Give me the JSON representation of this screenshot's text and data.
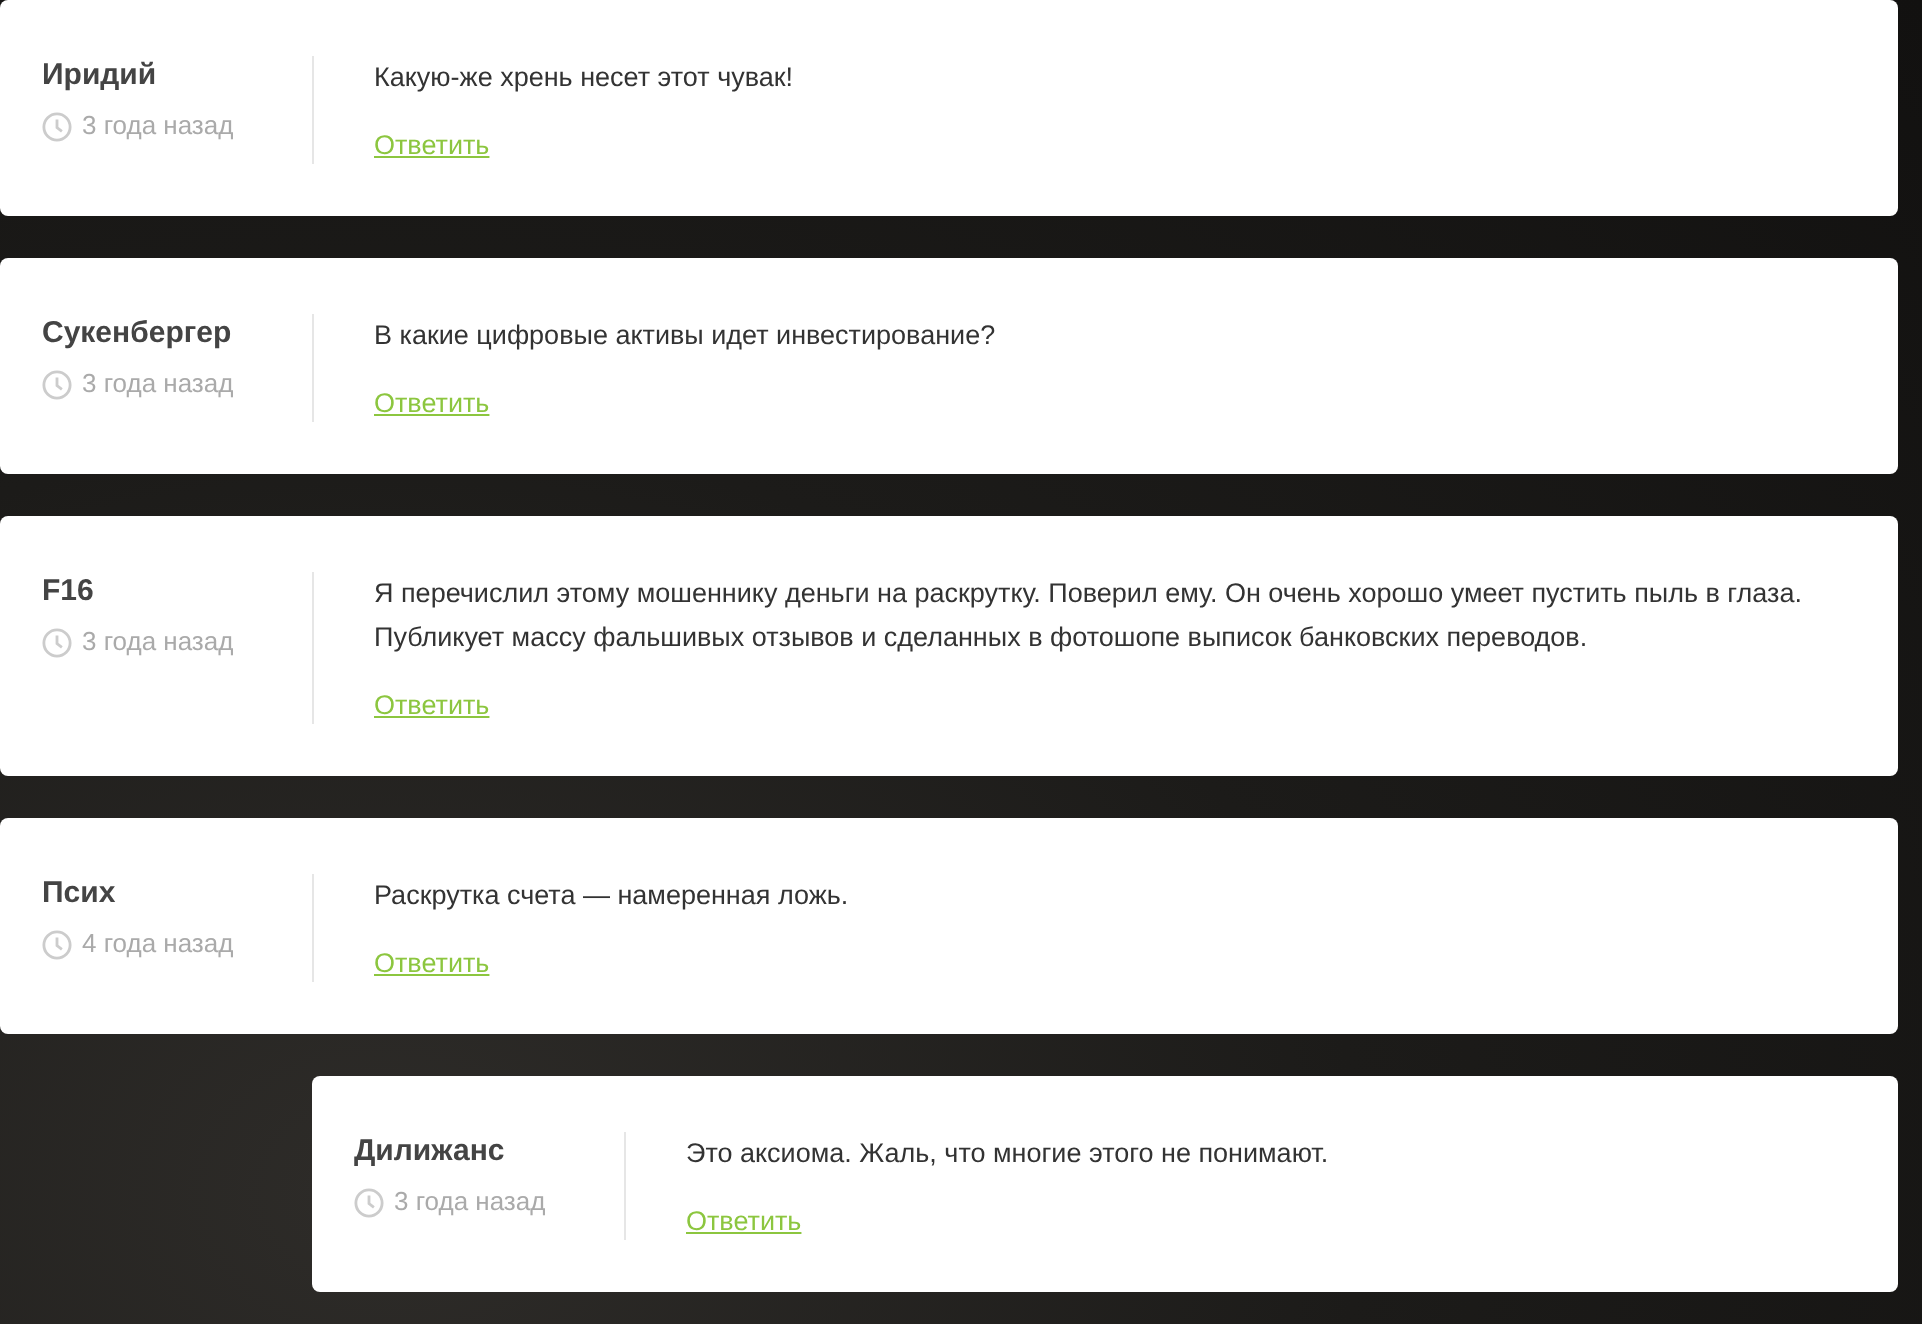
{
  "comments": [
    {
      "kind": "comment",
      "author": "Иридий",
      "time": "3 года назад",
      "text": "Какую-же хрень несет этот чувак!",
      "reply": "Ответить"
    },
    {
      "kind": "comment",
      "author": "Сукенбергер",
      "time": "3 года назад",
      "text": "В какие цифровые активы идет инвестирование?",
      "reply": "Ответить"
    },
    {
      "kind": "comment",
      "author": "F16",
      "time": "3 года назад",
      "text": "Я перечислил этому мошеннику деньги на раскрутку. Поверил ему. Он очень хорошо умеет пустить пыль в глаза. Публикует массу фальшивых отзывов и сделанных в фотошопе выписок банковских переводов.",
      "reply": "Ответить"
    },
    {
      "kind": "comment",
      "author": "Псих",
      "time": "4 года назад",
      "text": "Раскрутка счета — намеренная ложь.",
      "reply": "Ответить"
    },
    {
      "kind": "reply",
      "author": "Дилижанс",
      "time": "3 года назад",
      "text": "Это аксиома. Жаль, что многие этого не понимают.",
      "reply": "Ответить"
    }
  ]
}
